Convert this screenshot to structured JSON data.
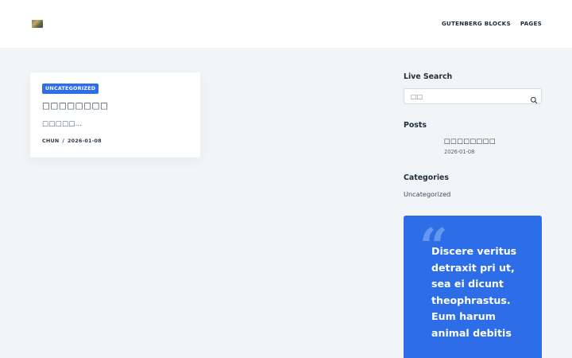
{
  "header": {
    "logo_icon": "site-logo-thumbnail",
    "nav": [
      "GUTENBERG BLOCKS",
      "PAGES"
    ]
  },
  "post": {
    "category": "UNCATEGORIZED",
    "title": "□□□□□□□□",
    "excerpt": "□□□□□…",
    "author": "CHUN",
    "separator": "/",
    "date": "2026-01-08"
  },
  "sidebar": {
    "search": {
      "title": "Live Search",
      "placeholder": "□□",
      "button_icon": "search-icon"
    },
    "posts": {
      "title": "Posts",
      "items": [
        {
          "title": "□□□□□□□□",
          "date": "2026-01-08"
        }
      ]
    },
    "categories": {
      "title": "Categories",
      "items": [
        "Uncategorized"
      ]
    },
    "quote": {
      "text": "Discere veritus detraxit pri ut, sea ei dicunt theophrastus. Eum harum animal debitis"
    }
  },
  "colors": {
    "accent": "#2d6ee8",
    "background": "#f2f5f7",
    "heading": "#1d2b3a"
  }
}
